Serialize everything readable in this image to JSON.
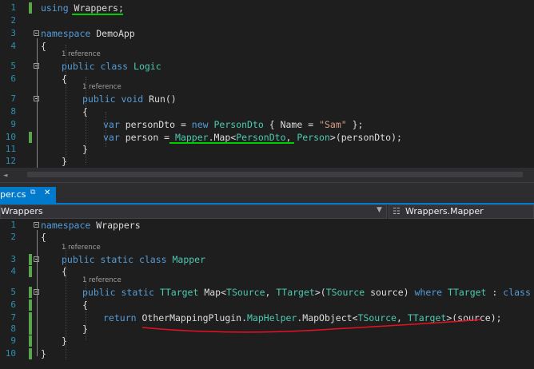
{
  "editor_top": {
    "lines": [
      {
        "n": "1",
        "tokens": [
          {
            "t": "using ",
            "c": "kw"
          },
          {
            "t": "Wrappers",
            "c": "tx"
          },
          {
            "t": ";",
            "c": "tx"
          }
        ]
      },
      {
        "n": "2",
        "tokens": []
      },
      {
        "n": "3",
        "tokens": [
          {
            "t": "namespace ",
            "c": "kw"
          },
          {
            "t": "DemoApp",
            "c": "tx"
          }
        ]
      },
      {
        "n": "4",
        "tokens": [
          {
            "t": "{",
            "c": "tx"
          }
        ]
      },
      {
        "n": "5",
        "ref": "1 reference",
        "tokens": [
          {
            "t": "public ",
            "c": "kw"
          },
          {
            "t": "class ",
            "c": "kw"
          },
          {
            "t": "Logic",
            "c": "ty"
          }
        ]
      },
      {
        "n": "6",
        "tokens": [
          {
            "t": "{",
            "c": "tx"
          }
        ]
      },
      {
        "n": "7",
        "ref": "1 reference",
        "tokens": [
          {
            "t": "public ",
            "c": "kw"
          },
          {
            "t": "void ",
            "c": "kw"
          },
          {
            "t": "Run()",
            "c": "tx"
          }
        ]
      },
      {
        "n": "8",
        "tokens": [
          {
            "t": "{",
            "c": "tx"
          }
        ]
      },
      {
        "n": "9",
        "tokens": [
          {
            "t": "var ",
            "c": "kw"
          },
          {
            "t": "personDto = ",
            "c": "tx"
          },
          {
            "t": "new ",
            "c": "kw"
          },
          {
            "t": "PersonDto",
            "c": "ty"
          },
          {
            "t": " { Name = ",
            "c": "tx"
          },
          {
            "t": "\"Sam\"",
            "c": "st"
          },
          {
            "t": " };",
            "c": "tx"
          }
        ]
      },
      {
        "n": "10",
        "tokens": [
          {
            "t": "var ",
            "c": "kw"
          },
          {
            "t": "person = ",
            "c": "tx"
          },
          {
            "t": "Mapper",
            "c": "ty"
          },
          {
            "t": ".Map<",
            "c": "tx"
          },
          {
            "t": "PersonDto",
            "c": "ty"
          },
          {
            "t": ", ",
            "c": "tx"
          },
          {
            "t": "Person",
            "c": "ty"
          },
          {
            "t": ">(personDto);",
            "c": "tx"
          }
        ]
      },
      {
        "n": "11",
        "tokens": [
          {
            "t": "}",
            "c": "tx"
          }
        ]
      },
      {
        "n": "12",
        "tokens": [
          {
            "t": "}",
            "c": "tx"
          }
        ]
      }
    ]
  },
  "scrollbar": {
    "zoom_arrow": "◄"
  },
  "tab": {
    "label": "per.cs",
    "pin": "⧉",
    "close": "✕"
  },
  "nav": {
    "left": "Wrappers",
    "caret": "▼",
    "right_icon": "☷",
    "right": "Wrappers.Mapper"
  },
  "editor_bottom": {
    "lines": [
      {
        "n": "1",
        "tokens": [
          {
            "t": "namespace ",
            "c": "kw"
          },
          {
            "t": "Wrappers",
            "c": "tx"
          }
        ]
      },
      {
        "n": "2",
        "tokens": [
          {
            "t": "{",
            "c": "tx"
          }
        ]
      },
      {
        "n": "3",
        "ref": "1 reference",
        "tokens": [
          {
            "t": "public ",
            "c": "kw"
          },
          {
            "t": "static ",
            "c": "kw"
          },
          {
            "t": "class ",
            "c": "kw"
          },
          {
            "t": "Mapper",
            "c": "ty"
          }
        ]
      },
      {
        "n": "4",
        "tokens": [
          {
            "t": "{",
            "c": "tx"
          }
        ]
      },
      {
        "n": "5",
        "ref": "1 reference",
        "tokens": [
          {
            "t": "public ",
            "c": "kw"
          },
          {
            "t": "static ",
            "c": "kw"
          },
          {
            "t": "TTarget",
            "c": "ty"
          },
          {
            "t": " Map<",
            "c": "tx"
          },
          {
            "t": "TSource",
            "c": "ty"
          },
          {
            "t": ", ",
            "c": "tx"
          },
          {
            "t": "TTarget",
            "c": "ty"
          },
          {
            "t": ">(",
            "c": "tx"
          },
          {
            "t": "TSource",
            "c": "ty"
          },
          {
            "t": " source) ",
            "c": "tx"
          },
          {
            "t": "where ",
            "c": "kw"
          },
          {
            "t": "TTarget",
            "c": "ty"
          },
          {
            "t": " : ",
            "c": "tx"
          },
          {
            "t": "class",
            "c": "kw"
          }
        ]
      },
      {
        "n": "6",
        "tokens": [
          {
            "t": "{",
            "c": "tx"
          }
        ]
      },
      {
        "n": "7",
        "tokens": [
          {
            "t": "return ",
            "c": "kw"
          },
          {
            "t": "OtherMappingPlugin",
            "c": "tx"
          },
          {
            "t": ".",
            "c": "tx"
          },
          {
            "t": "MapHelper",
            "c": "ty"
          },
          {
            "t": ".MapObject<",
            "c": "tx"
          },
          {
            "t": "TSource",
            "c": "ty"
          },
          {
            "t": ", ",
            "c": "tx"
          },
          {
            "t": "TTarget",
            "c": "ty"
          },
          {
            "t": ">(source);",
            "c": "tx"
          }
        ]
      },
      {
        "n": "8",
        "tokens": [
          {
            "t": "}",
            "c": "tx"
          }
        ]
      },
      {
        "n": "9",
        "tokens": [
          {
            "t": "}",
            "c": "tx"
          }
        ]
      },
      {
        "n": "10",
        "tokens": [
          {
            "t": "}",
            "c": "tx"
          }
        ]
      }
    ]
  },
  "colors": {
    "keyword": "#569cd6",
    "type": "#4ec9b0",
    "string": "#d69d85",
    "accent": "#007acc",
    "green_mark": "#00cc00",
    "red_mark": "#e81123"
  }
}
